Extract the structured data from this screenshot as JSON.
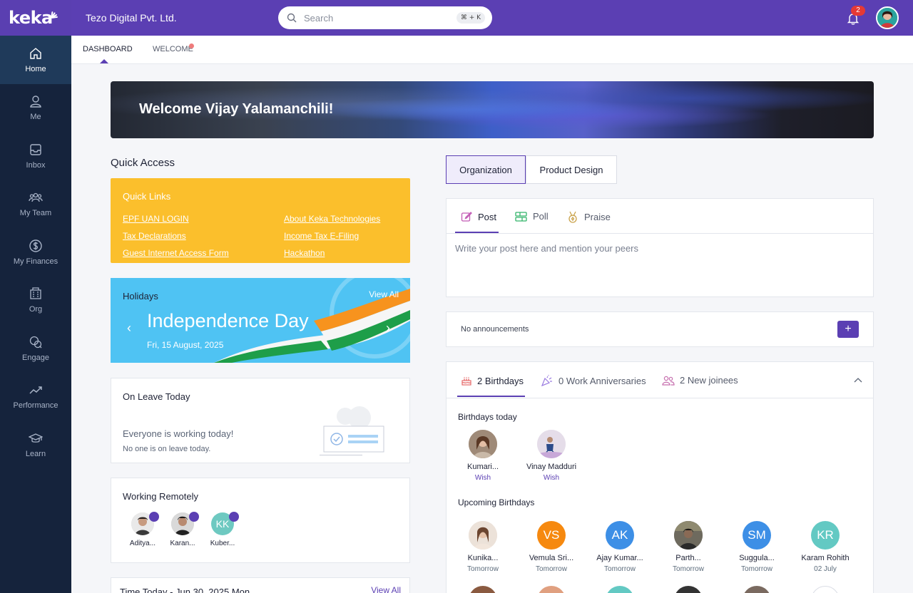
{
  "app": {
    "logo": "keka",
    "org_name": "Tezo Digital Pvt. Ltd.",
    "brand_color": "#5b3fb3",
    "sidebar_color": "#15233c"
  },
  "search": {
    "placeholder": "Search",
    "shortcut": "⌘ + K"
  },
  "notifications": {
    "count": "2"
  },
  "sidebar": {
    "items": [
      {
        "label": "Home",
        "icon": "home-icon"
      },
      {
        "label": "Me",
        "icon": "user-icon"
      },
      {
        "label": "Inbox",
        "icon": "inbox-icon"
      },
      {
        "label": "My Team",
        "icon": "team-icon"
      },
      {
        "label": "My Finances",
        "icon": "dollar-icon"
      },
      {
        "label": "Org",
        "icon": "org-icon"
      },
      {
        "label": "Engage",
        "icon": "engage-icon"
      },
      {
        "label": "Performance",
        "icon": "performance-icon"
      },
      {
        "label": "Learn",
        "icon": "graduation-cap-icon"
      }
    ]
  },
  "subtabs": [
    {
      "label": "DASHBOARD"
    },
    {
      "label": "WELCOME"
    }
  ],
  "banner": {
    "title": "Welcome Vijay Yalamanchili!"
  },
  "quick_access": {
    "title": "Quick Access",
    "quick_links_title": "Quick Links",
    "links": [
      "EPF UAN LOGIN",
      "About Keka Technologies",
      "Tax Declarations",
      "Income Tax E-Filing",
      "Guest Internet Access Form",
      "Hackathon"
    ]
  },
  "holidays": {
    "title": "Holidays",
    "view_all": "View All",
    "name": "Independence Day",
    "date": "Fri, 15 August, 2025"
  },
  "on_leave": {
    "title": "On Leave Today",
    "message": "Everyone is working today!",
    "sub": "No one is on leave today."
  },
  "remote": {
    "title": "Working Remotely",
    "people": [
      {
        "name": "Aditya..."
      },
      {
        "name": "Karan..."
      },
      {
        "name": "Kuber...",
        "initials": "KK"
      }
    ]
  },
  "time_today": {
    "title": "Time Today - Jun 30, 2025 Mon",
    "view_all": "View All"
  },
  "feed": {
    "segments": [
      "Organization",
      "Product Design"
    ],
    "post_tabs": [
      "Post",
      "Poll",
      "Praise"
    ],
    "post_placeholder": "Write your post here and mention your peers",
    "announcements": "No announcements",
    "add": "+"
  },
  "events": {
    "tabs": [
      "2 Birthdays",
      "0 Work Anniversaries",
      "2 New joinees"
    ],
    "today_title": "Birthdays today",
    "today": [
      {
        "name": "Kumari...",
        "action": "Wish"
      },
      {
        "name": "Vinay Madduri",
        "action": "Wish"
      }
    ],
    "upcoming_title": "Upcoming Birthdays",
    "upcoming": [
      {
        "name": "Kunika...",
        "when": "Tomorrow"
      },
      {
        "name": "Vemula Sri...",
        "when": "Tomorrow",
        "initials": "VS",
        "color": "#f6890f"
      },
      {
        "name": "Ajay Kumar...",
        "when": "Tomorrow",
        "initials": "AK",
        "color": "#3d8fe6"
      },
      {
        "name": "Parth...",
        "when": "Tomorrow"
      },
      {
        "name": "Suggula...",
        "when": "Tomorrow",
        "initials": "SM",
        "color": "#3d8fe6"
      },
      {
        "name": "Karam Rohith",
        "when": "02 July",
        "initials": "KR",
        "color": "#63c9c3"
      }
    ]
  }
}
